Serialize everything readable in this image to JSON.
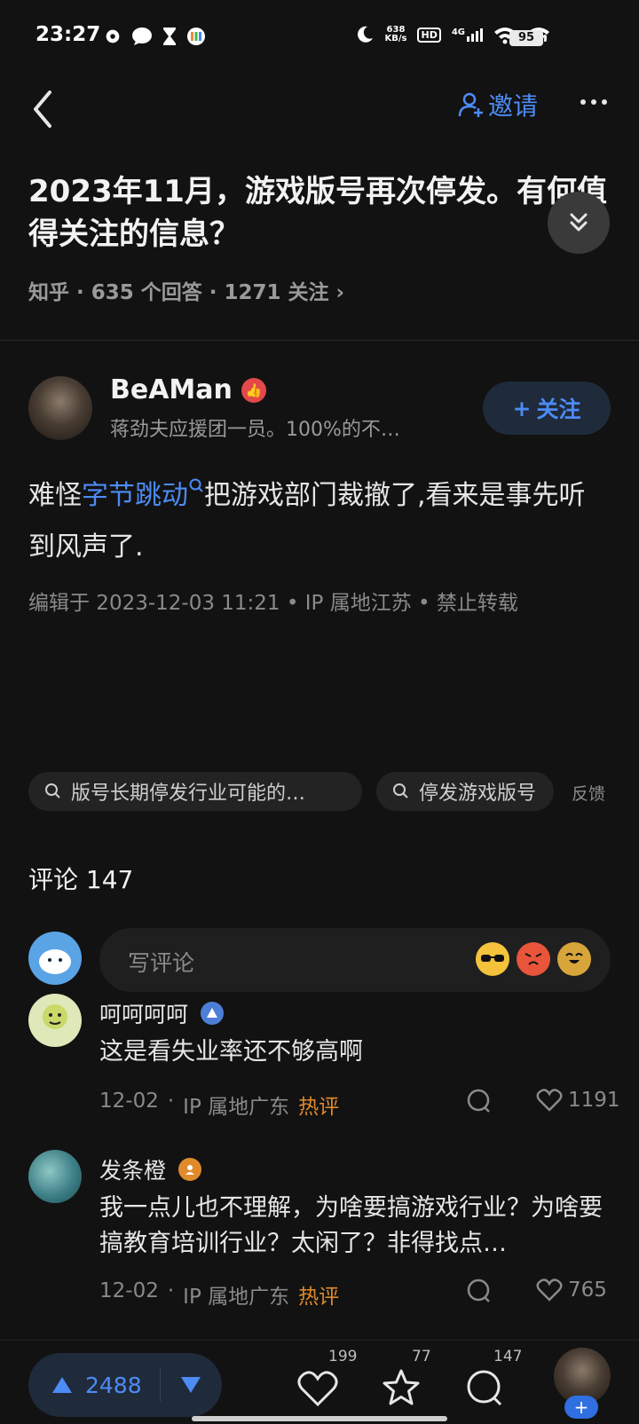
{
  "status_bar": {
    "time": "23:27",
    "net_speed_value": "638",
    "net_speed_unit": "KB/s",
    "hd": "HD",
    "network": "4G",
    "battery": "95"
  },
  "nav": {
    "invite_label": "邀请"
  },
  "question": {
    "title": "2023年11月，游戏版号再次停发。有何值得关注的信息？",
    "meta": "知乎 · 635 个回答 · 1271 关注 ›"
  },
  "author": {
    "name": "BeAMan",
    "bio": "蒋劲夫应援团一员。100%的不…",
    "follow_label": "关注"
  },
  "answer": {
    "text_before": "难怪",
    "link": "字节跳动",
    "text_after": "把游戏部门裁撤了,看来是事先听到风声了.",
    "meta": "编辑于 2023-12-03 11:21 • IP 属地江苏 • 禁止转载"
  },
  "related": {
    "chips": [
      "版号长期停发行业可能的…",
      "停发游戏版号"
    ],
    "feedback": "反馈"
  },
  "comments": {
    "header": "评论 147",
    "placeholder": "写评论",
    "items": [
      {
        "name": "呵呵呵呵",
        "text": "这是看失业率还不够高啊",
        "date": "12-02",
        "location": "IP 属地广东",
        "tag": "热评",
        "likes": "1191"
      },
      {
        "name": "发条橙",
        "text": "我一点儿也不理解，为啥要搞游戏行业？为啥要搞教育培训行业？太闲了？非得找点…",
        "date": "12-02",
        "location": "IP 属地广东",
        "tag": "热评",
        "likes": "765"
      }
    ]
  },
  "bottom_bar": {
    "upvotes": "2488",
    "likes": "199",
    "favorites": "77",
    "comments": "147"
  },
  "colors": {
    "accent": "#4d8bf5",
    "hot": "#e08a2c",
    "background": "#121212"
  }
}
